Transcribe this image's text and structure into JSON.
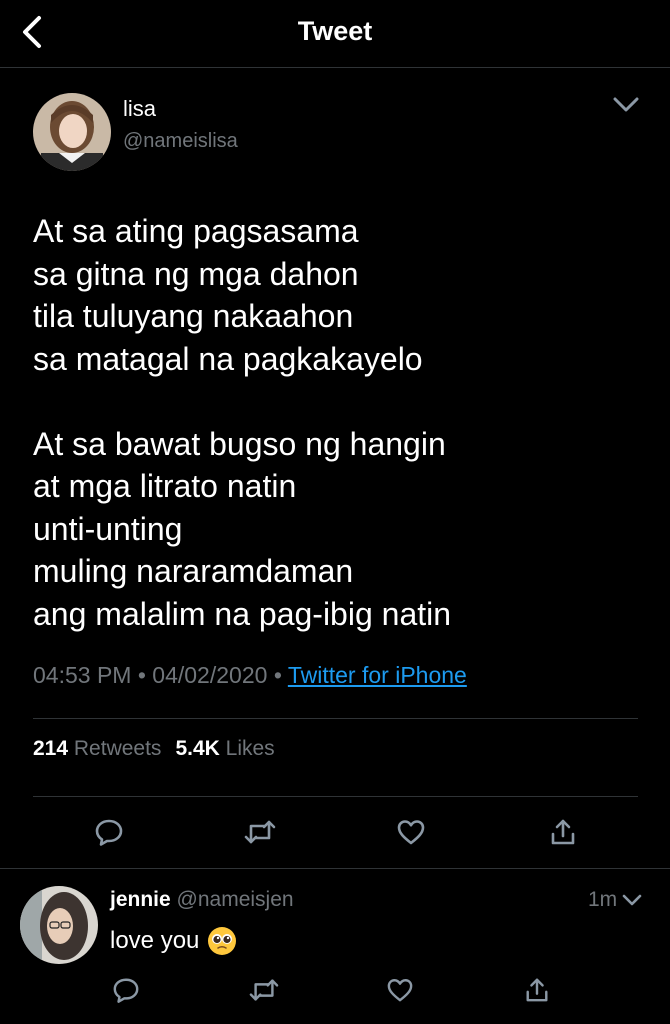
{
  "header": {
    "title": "Tweet",
    "back_icon": "back-arrow-icon"
  },
  "tweet": {
    "author": {
      "name": "lisa",
      "handle": "@nameislisa"
    },
    "text": "At sa ating pagsasama\nsa gitna ng mga dahon\ntila tuluyang nakaahon\nsa matagal na pagkakayelo\n\nAt sa bawat bugso ng hangin\nat mga litrato natin\nunti-unting\nmuling nararamdaman\nang malalim na pag-ibig natin",
    "time": "04:53 PM",
    "date": "04/02/2020",
    "separator": "•",
    "source": "Twitter for iPhone",
    "retweets_count": "214",
    "retweets_label": "Retweets",
    "likes_count": "5.4K",
    "likes_label": "Likes"
  },
  "reply": {
    "name": "jennie",
    "handle": "@nameisjen",
    "time": "1m",
    "text": "love you",
    "emoji": "pleading-face-emoji"
  },
  "colors": {
    "background": "#000000",
    "text": "#ffffff",
    "muted": "#71767b",
    "link": "#1d9bf0",
    "divider": "#2f3336"
  }
}
